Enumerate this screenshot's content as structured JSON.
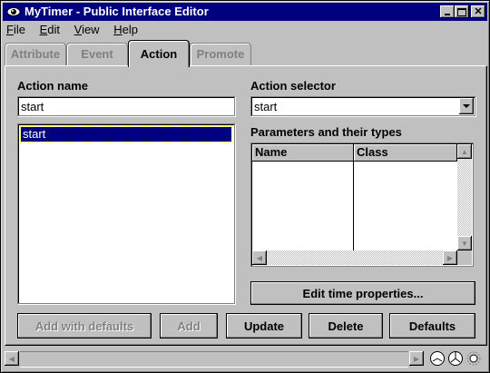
{
  "window": {
    "title": "MyTimer - Public Interface Editor"
  },
  "menu": [
    {
      "label": "File"
    },
    {
      "label": "Edit"
    },
    {
      "label": "View"
    },
    {
      "label": "Help"
    }
  ],
  "tabs": [
    {
      "label": "Attribute",
      "active": false
    },
    {
      "label": "Event",
      "active": false
    },
    {
      "label": "Action",
      "active": true
    },
    {
      "label": "Promote",
      "active": false
    }
  ],
  "action_name": {
    "label": "Action name",
    "value": "start"
  },
  "action_list": {
    "items": [
      "start"
    ],
    "selected": "start"
  },
  "action_selector": {
    "label": "Action selector",
    "value": "start"
  },
  "parameters": {
    "label": "Parameters and their types",
    "columns": [
      "Name",
      "Class"
    ]
  },
  "buttons": {
    "edit_time": "Edit time properties...",
    "add_with_defaults": "Add with defaults",
    "add": "Add",
    "update": "Update",
    "delete": "Delete",
    "defaults": "Defaults"
  },
  "colors": {
    "titlebar": "#000080",
    "face": "#c0c0c0",
    "selection": "#000080"
  }
}
